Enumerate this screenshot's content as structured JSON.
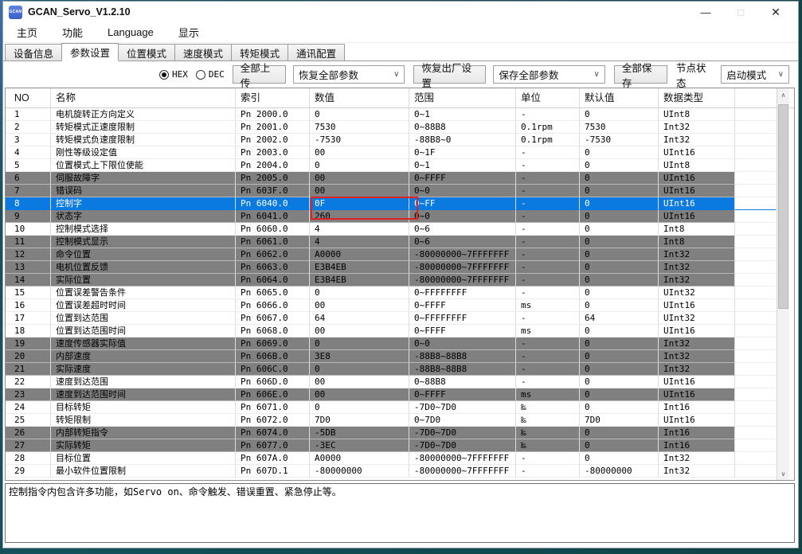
{
  "window": {
    "title": "GCAN_Servo_V1.2.10",
    "icon_label": "GCAN",
    "controls": {
      "minimize": "—",
      "maximize": "□",
      "close": "✕"
    }
  },
  "menu": {
    "items": [
      "主页",
      "功能",
      "Language",
      "显示"
    ]
  },
  "tabs": {
    "items": [
      "设备信息",
      "参数设置",
      "位置模式",
      "速度模式",
      "转矩模式",
      "通讯配置"
    ],
    "active": "参数设置"
  },
  "toolbar": {
    "radio_hex": "HEX",
    "radio_dec": "DEC",
    "radio_selected": "HEX",
    "upload_all_label": "全部上传",
    "restore_all_params_value": "恢复全部参数",
    "factory_reset_label": "恢复出厂设置",
    "save_all_params_value": "保存全部参数",
    "save_all_label": "全部保存",
    "node_status_label": "节点状态",
    "node_status_value": "启动模式"
  },
  "icons": {
    "dropdown_chevron": "∨",
    "scroll_up": "∧",
    "scroll_down": "∨"
  },
  "table": {
    "headers": [
      "NO",
      "名称",
      "索引",
      "数值",
      "范围",
      "单位",
      "默认值",
      "数据类型"
    ],
    "rows": [
      {
        "no": "1",
        "name": "电机旋转正方向定义",
        "index": "Pn 2000.0",
        "value": "0",
        "range": "0~1",
        "unit": "-",
        "default": "0",
        "type": "UInt8",
        "style": "white"
      },
      {
        "no": "2",
        "name": "转矩模式正速度限制",
        "index": "Pn 2001.0",
        "value": "7530",
        "range": "0~88B8",
        "unit": "0.1rpm",
        "default": "7530",
        "type": "Int32",
        "style": "white"
      },
      {
        "no": "3",
        "name": "转矩模式负速度限制",
        "index": "Pn 2002.0",
        "value": "-7530",
        "range": "-88B8~0",
        "unit": "0.1rpm",
        "default": "-7530",
        "type": "Int32",
        "style": "white"
      },
      {
        "no": "4",
        "name": "刚性等级设定值",
        "index": "Pn 2003.0",
        "value": "00",
        "range": "0~1F",
        "unit": "-",
        "default": "0",
        "type": "UInt16",
        "style": "white"
      },
      {
        "no": "5",
        "name": "位置模式上下限位使能",
        "index": "Pn 2004.0",
        "value": "0",
        "range": "0~1",
        "unit": "-",
        "default": "0",
        "type": "UInt8",
        "style": "white"
      },
      {
        "no": "6",
        "name": "伺服故障字",
        "index": "Pn 2005.0",
        "value": "00",
        "range": "0~FFFF",
        "unit": "-",
        "default": "0",
        "type": "UInt16",
        "style": "gray"
      },
      {
        "no": "7",
        "name": "错误码",
        "index": "Pn 603F.0",
        "value": "00",
        "range": "0~0",
        "unit": "-",
        "default": "0",
        "type": "UInt16",
        "style": "gray"
      },
      {
        "no": "8",
        "name": "控制字",
        "index": "Pn 6040.0",
        "value": "0F",
        "range": "0~FF",
        "unit": "-",
        "default": "0",
        "type": "UInt16",
        "style": "selected",
        "highlight": true
      },
      {
        "no": "9",
        "name": "状态字",
        "index": "Pn 6041.0",
        "value": "260",
        "range": "0~0",
        "unit": "-",
        "default": "0",
        "type": "UInt16",
        "style": "gray"
      },
      {
        "no": "10",
        "name": "控制模式选择",
        "index": "Pn 6060.0",
        "value": "4",
        "range": "0~6",
        "unit": "-",
        "default": "0",
        "type": "Int8",
        "style": "white"
      },
      {
        "no": "11",
        "name": "控制模式显示",
        "index": "Pn 6061.0",
        "value": "4",
        "range": "0~6",
        "unit": "-",
        "default": "0",
        "type": "Int8",
        "style": "gray"
      },
      {
        "no": "12",
        "name": "命令位置",
        "index": "Pn 6062.0",
        "value": "A0000",
        "range": "-80000000~7FFFFFFF",
        "unit": "-",
        "default": "0",
        "type": "Int32",
        "style": "gray"
      },
      {
        "no": "13",
        "name": "电机位置反馈",
        "index": "Pn 6063.0",
        "value": "E3B4EB",
        "range": "-80000000~7FFFFFFF",
        "unit": "-",
        "default": "0",
        "type": "Int32",
        "style": "gray"
      },
      {
        "no": "14",
        "name": "实际位置",
        "index": "Pn 6064.0",
        "value": "E3B4EB",
        "range": "-80000000~7FFFFFFF",
        "unit": "-",
        "default": "0",
        "type": "Int32",
        "style": "gray"
      },
      {
        "no": "15",
        "name": "位置误差警告条件",
        "index": "Pn 6065.0",
        "value": "0",
        "range": "0~FFFFFFFF",
        "unit": "-",
        "default": "0",
        "type": "UInt32",
        "style": "white"
      },
      {
        "no": "16",
        "name": "位置误差超时时间",
        "index": "Pn 6066.0",
        "value": "00",
        "range": "0~FFFF",
        "unit": "ms",
        "default": "0",
        "type": "UInt16",
        "style": "white"
      },
      {
        "no": "17",
        "name": "位置到达范围",
        "index": "Pn 6067.0",
        "value": "64",
        "range": "0~FFFFFFFF",
        "unit": "-",
        "default": "64",
        "type": "UInt32",
        "style": "white"
      },
      {
        "no": "18",
        "name": "位置到达范围时间",
        "index": "Pn 6068.0",
        "value": "00",
        "range": "0~FFFF",
        "unit": "ms",
        "default": "0",
        "type": "UInt16",
        "style": "white"
      },
      {
        "no": "19",
        "name": "速度传感器实际值",
        "index": "Pn 6069.0",
        "value": "0",
        "range": "0~0",
        "unit": "-",
        "default": "0",
        "type": "Int32",
        "style": "gray"
      },
      {
        "no": "20",
        "name": "内部速度",
        "index": "Pn 606B.0",
        "value": "3E8",
        "range": "-88B8~88B8",
        "unit": "-",
        "default": "0",
        "type": "Int32",
        "style": "gray"
      },
      {
        "no": "21",
        "name": "实际速度",
        "index": "Pn 606C.0",
        "value": "0",
        "range": "-88B8~88B8",
        "unit": "-",
        "default": "0",
        "type": "Int32",
        "style": "gray"
      },
      {
        "no": "22",
        "name": "速度到达范围",
        "index": "Pn 606D.0",
        "value": "00",
        "range": "0~88B8",
        "unit": "-",
        "default": "0",
        "type": "UInt16",
        "style": "white"
      },
      {
        "no": "23",
        "name": "速度到达范围时间",
        "index": "Pn 606E.0",
        "value": "00",
        "range": "0~FFFF",
        "unit": "ms",
        "default": "0",
        "type": "UInt16",
        "style": "gray"
      },
      {
        "no": "24",
        "name": "目标转矩",
        "index": "Pn 6071.0",
        "value": "0",
        "range": "-7D0~7D0",
        "unit": "‰",
        "default": "0",
        "type": "Int16",
        "style": "white"
      },
      {
        "no": "25",
        "name": "转矩限制",
        "index": "Pn 6072.0",
        "value": "7D0",
        "range": "0~7D0",
        "unit": "‰",
        "default": "7D0",
        "type": "UInt16",
        "style": "white"
      },
      {
        "no": "26",
        "name": "内部转矩指令",
        "index": "Pn 6074.0",
        "value": "-5DB",
        "range": "-7D0~7D0",
        "unit": "‰",
        "default": "0",
        "type": "Int16",
        "style": "gray"
      },
      {
        "no": "27",
        "name": "实际转矩",
        "index": "Pn 6077.0",
        "value": "-3EC",
        "range": "-7D0~7D0",
        "unit": "‰",
        "default": "0",
        "type": "Int16",
        "style": "gray"
      },
      {
        "no": "28",
        "name": "目标位置",
        "index": "Pn 607A.0",
        "value": "A0000",
        "range": "-80000000~7FFFFFFF",
        "unit": "-",
        "default": "0",
        "type": "Int32",
        "style": "white"
      },
      {
        "no": "29",
        "name": "最小软件位置限制",
        "index": "Pn 607D.1",
        "value": "-80000000",
        "range": "-80000000~7FFFFFFF",
        "unit": "-",
        "default": "-80000000",
        "type": "Int32",
        "style": "white"
      }
    ]
  },
  "description": "控制指令内包含许多功能，如Servo on、命令触发、错误重置、紧急停止等。",
  "colors": {
    "selected_row": "#0a7ae0",
    "readonly_row": "#808080",
    "highlight_box": "#e02321",
    "app_icon": "#4a6fd4"
  }
}
